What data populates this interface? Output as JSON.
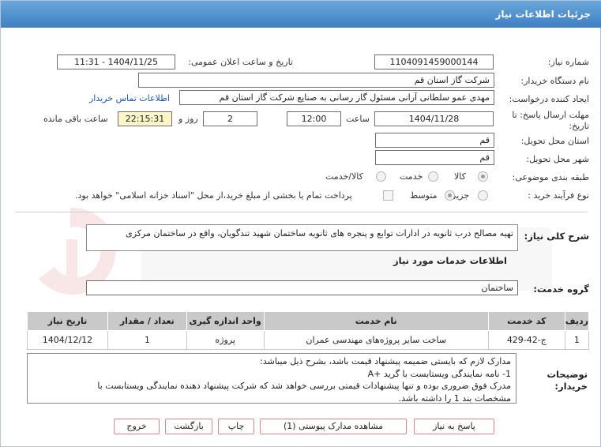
{
  "header": {
    "title": "جزئیات اطلاعات نیاز"
  },
  "fields": {
    "need_number_label": "شماره نیاز:",
    "need_number": "1104091459000144",
    "announce_label": "تاریخ و ساعت اعلان عمومی:",
    "announce_value": "1404/11/25 - 11:31",
    "buyer_org_label": "نام دستگاه خریدار:",
    "buyer_org": "شرکت گاز استان قم",
    "creator_label": "ایجاد کننده درخواست:",
    "creator": "مهدی عمو سلطانی آرانی مسئول گاز رسانی به صنایع شرکت گاز استان قم",
    "contact_link": "اطلاعات تماس خریدار",
    "deadline_label": "مهلت ارسال پاسخ: تا",
    "deadline_label2": "تاریخ:",
    "deadline_date": "1404/11/28",
    "time_label": "ساعت",
    "deadline_time": "12:00",
    "days_value": "2",
    "days_label": "روز و",
    "remaining_time": "22:15:31",
    "remaining_label": "ساعت باقی مانده",
    "province_label": "استان محل تحویل:",
    "province": "قم",
    "city_label": "شهر محل تحویل:",
    "city": "قم",
    "category_label": "طبقه بندی موضوعی:",
    "category_options": [
      "کالا",
      "خدمت",
      "کالا/خدمت"
    ],
    "process_label": "نوع فرآیند خرید :",
    "process_options": [
      "جزیی",
      "متوسط"
    ],
    "process_note": "پرداخت تمام یا بخشی از مبلغ خرید،از محل \"اسناد خزانه اسلامی\" خواهد بود."
  },
  "description": {
    "label": "شرح کلی نیاز:",
    "text": "تهیه مصالح درب ثانویه در ادارات توابع و پنجره های ثانویه ساختمان شهید تندگویان، واقع در ساختمان مرکزی"
  },
  "services": {
    "title": "اطلاعات خدمات مورد نیاز",
    "group_label": "گروه خدمت:",
    "group_value": "ساختمان",
    "columns": [
      "ردیف",
      "کد خدمت",
      "نام خدمت",
      "واحد اندازه گیری",
      "تعداد / مقدار",
      "تاریخ نیاز"
    ],
    "rows": [
      [
        "1",
        "ج-42-429",
        "ساخت سایر پروژه‌های مهندسی عمران",
        "پروژه",
        "1",
        "1404/12/12"
      ]
    ]
  },
  "notes": {
    "label": "توضیحات خریدار:",
    "lines": [
      "مدارک لازم که بایستی ضمیمه پیشنهاد قیمت باشد، بشرح ذیل میباشد:",
      "1- نامه نمایندگی ویستابست با گرید +A",
      "مدرک فوق ضروری بوده و تنها پیشنهادات قیمتی بررسی خواهد شد که شرکت پیشنهاد دهنده نمایندگی ویستابست با",
      "مشخصات بند 1 را داشته باشد."
    ]
  },
  "buttons": {
    "reply": "پاسخ به نیاز",
    "attachments": "مشاهده مدارک پیوستی (1)",
    "print": "چاپ",
    "back": "بازگشت",
    "exit": "خروج"
  },
  "colors": {
    "header": "#4a8bd0",
    "link": "#1a55b0",
    "button_border": "#d18b8b",
    "highlight": "#fbf5c8"
  }
}
